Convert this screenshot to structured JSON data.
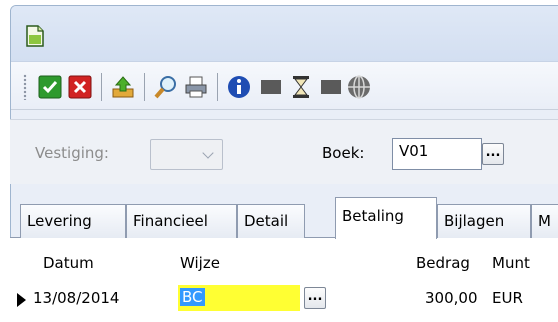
{
  "toolbar": {
    "icons": [
      "check-icon",
      "close-icon",
      "upload-icon",
      "search-icon",
      "print-icon",
      "info-icon",
      "stop-icon",
      "hourglass-icon",
      "stop-icon",
      "globe-icon"
    ],
    "colors": {
      "check": "#2e9a2e",
      "close": "#d12323",
      "info": "#1f4db3"
    }
  },
  "form": {
    "vestiging_label": "Vestiging:",
    "vestiging_value": "",
    "boek_label": "Boek:",
    "boek_value": "V01",
    "lookup_label": "..."
  },
  "tabs": [
    {
      "label": "Levering"
    },
    {
      "label": "Financieel"
    },
    {
      "label": "Detail"
    },
    {
      "label": "Betaling"
    },
    {
      "label": "Bijlagen"
    },
    {
      "label": "M"
    }
  ],
  "active_tab": "Betaling",
  "grid": {
    "columns": [
      "Datum",
      "Wijze",
      "Bedrag",
      "Munt"
    ],
    "rows": [
      {
        "datum": "13/08/2014",
        "wijze": "BC",
        "bedrag": "300,00",
        "munt": "EUR",
        "lookup": "..."
      }
    ]
  },
  "colors": {
    "editor_bg": "#ffff33",
    "selection": "#3399ff"
  }
}
